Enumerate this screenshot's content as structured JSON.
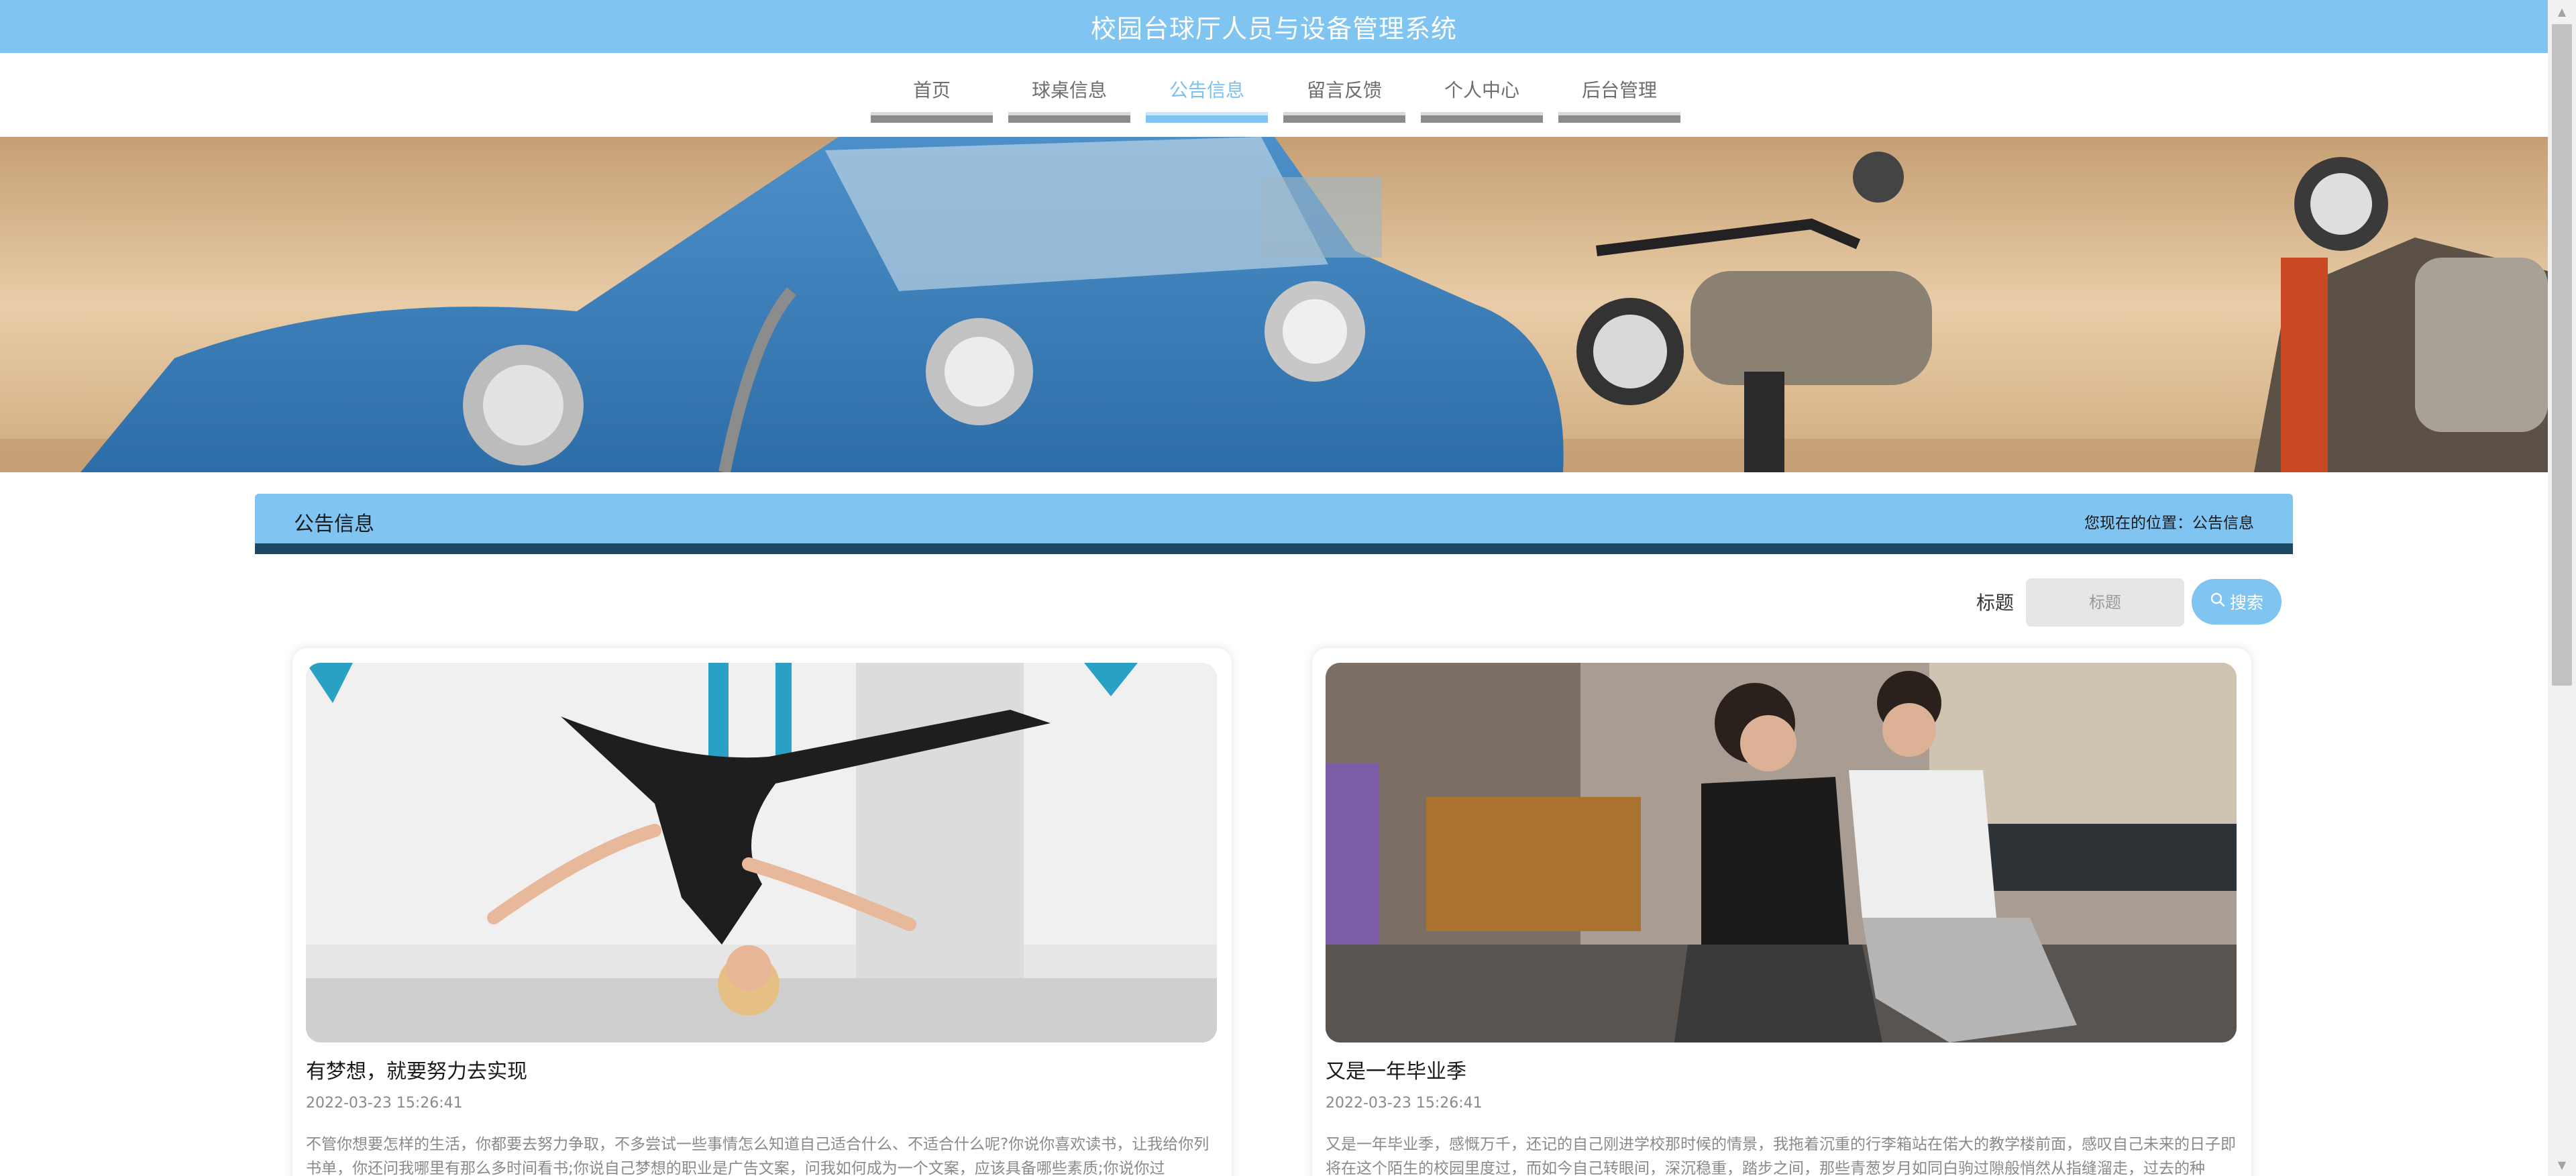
{
  "header": {
    "title": "校园台球厅人员与设备管理系统"
  },
  "nav": {
    "items": [
      {
        "label": "首页"
      },
      {
        "label": "球桌信息"
      },
      {
        "label": "公告信息"
      },
      {
        "label": "留言反馈"
      },
      {
        "label": "个人中心"
      },
      {
        "label": "后台管理"
      }
    ],
    "active": "公告信息"
  },
  "section": {
    "title": "公告信息",
    "breadcrumb": "您现在的位置：公告信息"
  },
  "search": {
    "label": "标题",
    "placeholder": "标题",
    "button_label": "搜索",
    "button_icon": "search-icon"
  },
  "notices": [
    {
      "title": "有梦想，就要努力去实现",
      "date": "2022-03-23 15:26:41",
      "summary": "不管你想要怎样的生活，你都要去努力争取，不多尝试一些事情怎么知道自己适合什么、不适合什么呢?你说你喜欢读书，让我给你列书单，你还问我哪里有那么多时间看书;你说自己梦想的职业是广告文案，问我如何成为一个文案，应该具备哪些素质;你说你过"
    },
    {
      "title": "又是一年毕业季",
      "date": "2022-03-23 15:26:41",
      "summary": "又是一年毕业季，感慨万千，还记的自己刚进学校那时候的情景，我拖着沉重的行李箱站在偌大的教学楼前面，感叹自己未来的日子即将在这个陌生的校园里度过，而如今自己转眼间，深沉稳重，踏步之间，那些青葱岁月如同白驹过隙般悄然从指缝溜走，过去的种"
    }
  ],
  "colors": {
    "accent": "#80c4f2",
    "header_underline": "#1b4862",
    "nav_inactive_text": "#6d6d6d"
  }
}
